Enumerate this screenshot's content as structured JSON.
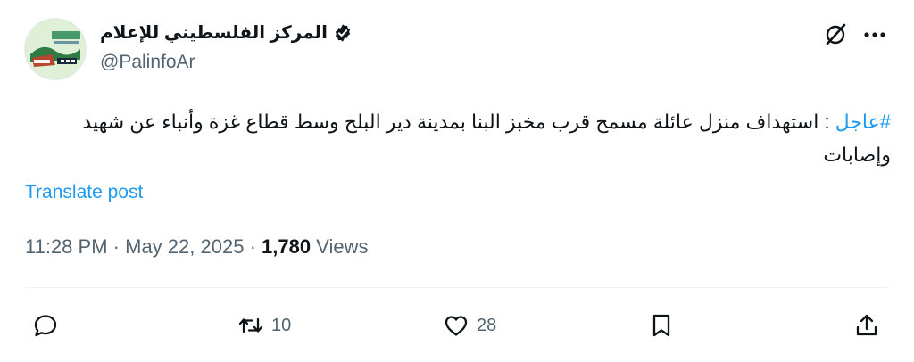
{
  "author": {
    "display_name": "المركز الفلسطيني للإعلام",
    "handle": "@PalinfoAr",
    "verified": true
  },
  "tweet": {
    "hashtag": "#عاجل",
    "body": " :  استهداف منزل عائلة مسمح قرب مخبز البنا بمدينة دير البلح وسط قطاع غزة وأنباء عن شهيد وإصابات"
  },
  "translate_label": "Translate post",
  "meta": {
    "time": "11:28 PM",
    "separator": "·",
    "date": "May 22, 2025",
    "views_count": "1,780",
    "views_label": "Views"
  },
  "actions": {
    "reply_count": "",
    "retweet_count": "10",
    "like_count": "28"
  },
  "colors": {
    "accent": "#1d9bf0",
    "text": "#0f1419",
    "secondary": "#536471",
    "divider": "#eff3f4"
  },
  "icons": [
    "avatar-logo",
    "verified-badge-icon",
    "grok-icon",
    "more-icon",
    "reply-icon",
    "retweet-icon",
    "like-icon",
    "bookmark-icon",
    "share-icon"
  ]
}
